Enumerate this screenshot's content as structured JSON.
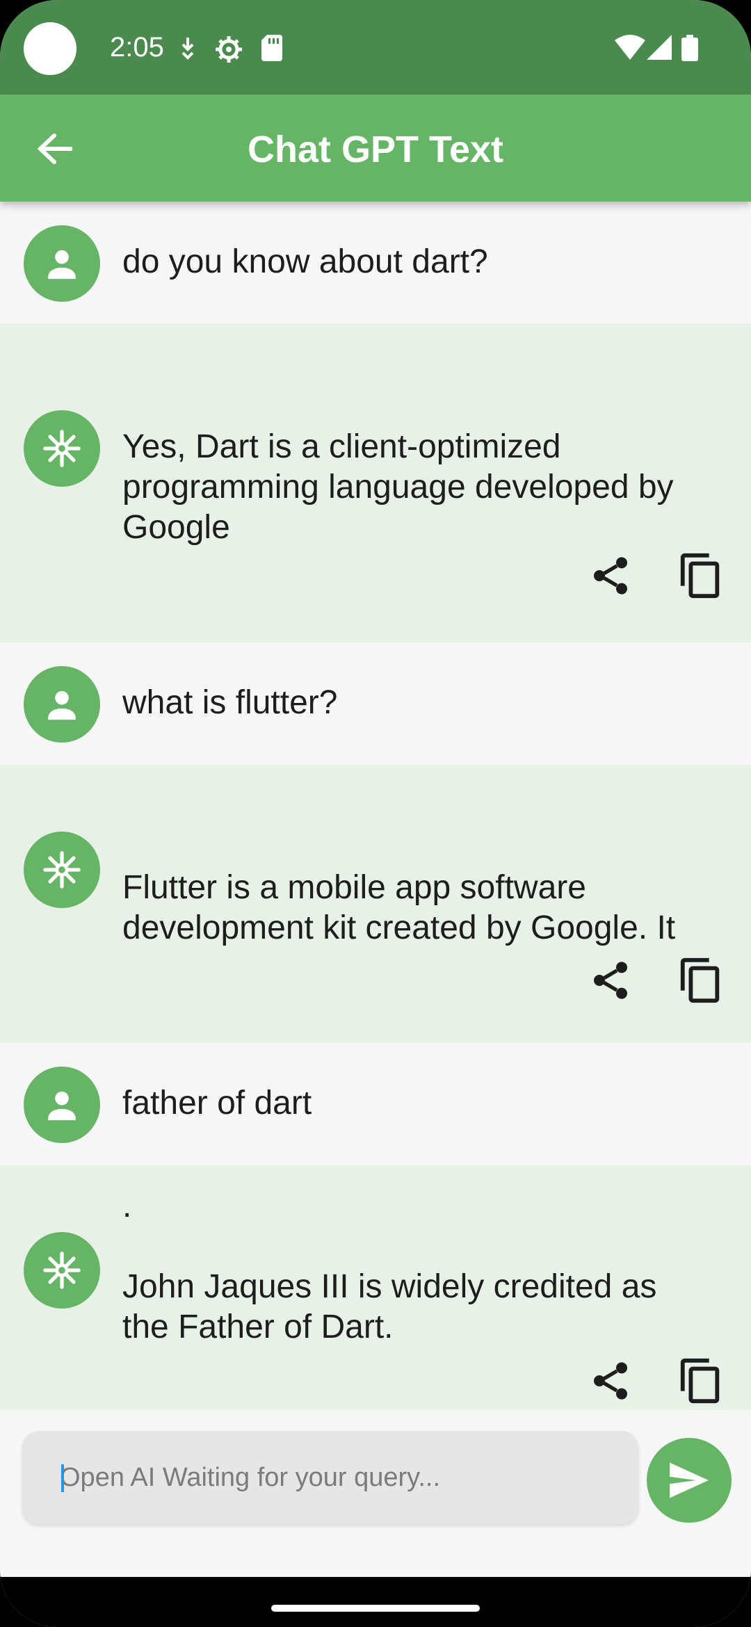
{
  "status_bar": {
    "time": "2:05",
    "left_icons": [
      "download-status-icon",
      "settings-status-icon",
      "sd-card-icon"
    ],
    "right_icons": [
      "wifi-icon",
      "signal-icon",
      "battery-icon"
    ]
  },
  "app_bar": {
    "title": "Chat GPT Text",
    "back_icon": "arrow-back-icon"
  },
  "messages": [
    {
      "role": "user",
      "text": "do you know about dart?"
    },
    {
      "role": "bot",
      "text": "Yes, Dart is a client-optimized programming language developed by Google",
      "actions": [
        "share-icon",
        "copy-icon"
      ]
    },
    {
      "role": "user",
      "text": "what is flutter?"
    },
    {
      "role": "bot",
      "text": "Flutter is a mobile app software development kit created by Google. It",
      "actions": [
        "share-icon",
        "copy-icon"
      ]
    },
    {
      "role": "user",
      "text": "father of dart"
    },
    {
      "role": "bot",
      "text": ".\n\nJohn Jaques III is widely credited as the Father of Dart.",
      "actions": [
        "share-icon",
        "copy-icon"
      ]
    }
  ],
  "input": {
    "placeholder": "Open AI Waiting for your query...",
    "value": ""
  },
  "colors": {
    "status_bar": "#4b8a4e",
    "app_bar": "#66b566",
    "bot_bubble": "#e8f1e7",
    "user_bubble": "#f7f7f7",
    "accent": "#66b566"
  }
}
